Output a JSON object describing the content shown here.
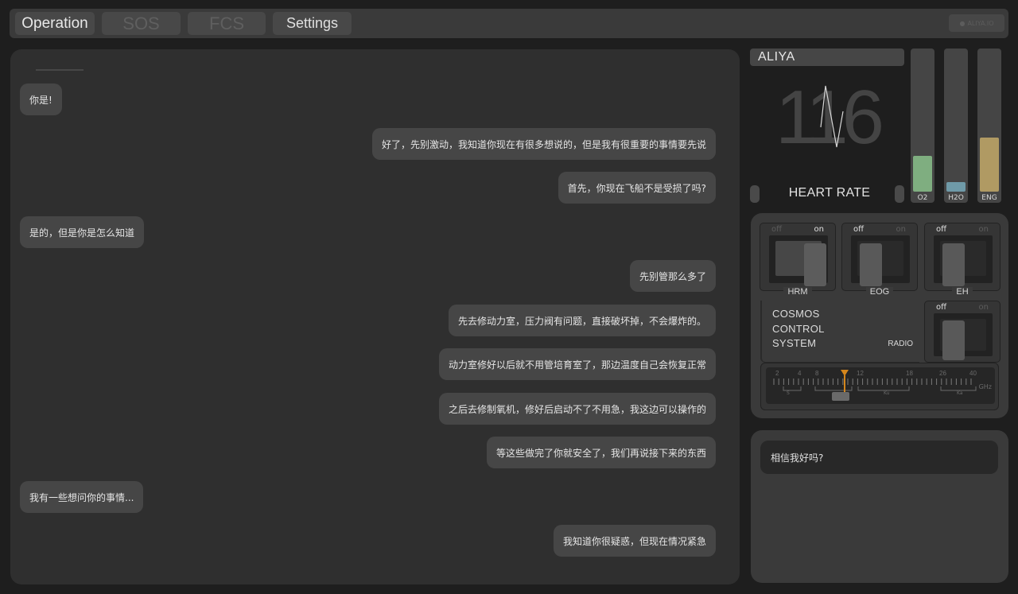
{
  "tabs": [
    {
      "label": "Operation",
      "state": "active"
    },
    {
      "label": "SOS",
      "state": "inactive"
    },
    {
      "label": "FCS",
      "state": "inactive"
    },
    {
      "label": "Settings",
      "state": "normal"
    }
  ],
  "user_chip": {
    "icon": "user-icon",
    "text": "ALIYA.IO"
  },
  "messages": [
    {
      "side": "left",
      "text": "你是!"
    },
    {
      "side": "right",
      "text": "好了，先别激动，我知道你现在有很多想说的，但是我有很重要的事情要先说"
    },
    {
      "side": "right",
      "text": "首先，你现在飞船不是受损了吗?"
    },
    {
      "side": "left",
      "text": "是的，但是你是怎么知道"
    },
    {
      "side": "right",
      "text": "先别管那么多了"
    },
    {
      "side": "right",
      "text": "先去修动力室，压力阀有问题，直接破坏掉，不会爆炸的。"
    },
    {
      "side": "right",
      "text": "动力室修好以后就不用管培育室了，那边温度自己会恢复正常"
    },
    {
      "side": "right",
      "text": "之后去修制氧机，修好后启动不了不用急，我这边可以操作的"
    },
    {
      "side": "right",
      "text": "等这些做完了你就安全了，我们再说接下来的东西"
    },
    {
      "side": "left",
      "text": "我有一些想问你的事情..."
    },
    {
      "side": "right",
      "text": "我知道你很疑惑，但现在情况紧急"
    }
  ],
  "monitor": {
    "name": "ALIYA",
    "heart_rate": "116",
    "heart_rate_label": "HEART RATE"
  },
  "gauges": [
    {
      "label": "O2",
      "level": 0.26,
      "color": "#7fae80"
    },
    {
      "label": "H2O",
      "level": 0.07,
      "color": "#6f9aa8"
    },
    {
      "label": "ENG",
      "level": 0.39,
      "color": "#b09a63"
    }
  ],
  "switches": {
    "off_label": "off",
    "on_label": "on",
    "hrm": {
      "name": "HRM",
      "state": "on"
    },
    "eog": {
      "name": "EOG",
      "state": "off"
    },
    "eh": {
      "name": "EH",
      "state": "off"
    },
    "radio": {
      "name": "RADIO",
      "state": "off"
    }
  },
  "system": {
    "line1": "COSMOS",
    "line2": "CONTROL",
    "line3": "SYSTEM"
  },
  "tuner": {
    "ticks": [
      "2",
      "4",
      "8",
      "12",
      "18",
      "26",
      "40"
    ],
    "unit": "GHz",
    "band_labels": [
      "S",
      "Ku",
      "Ka"
    ],
    "accent": "#d4861c"
  },
  "reply_prompt": "相信我好吗?"
}
